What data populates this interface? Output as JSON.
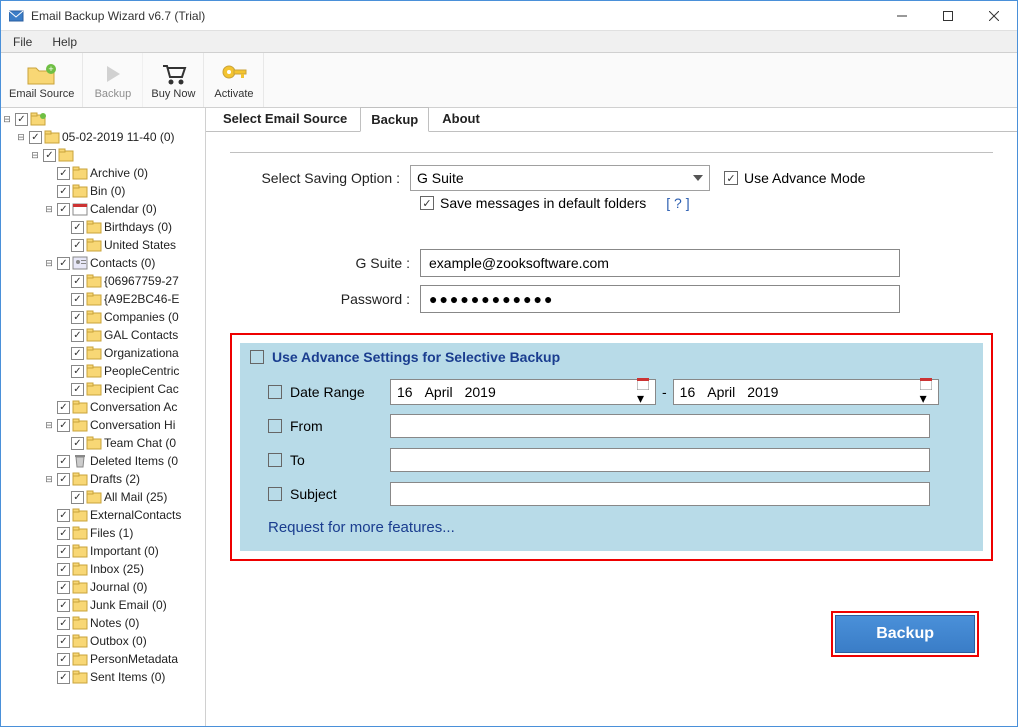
{
  "titlebar": {
    "title": "Email Backup Wizard v6.7 (Trial)"
  },
  "menu": {
    "file": "File",
    "help": "Help"
  },
  "toolbar": {
    "email_source": "Email Source",
    "backup": "Backup",
    "buy_now": "Buy Now",
    "activate": "Activate"
  },
  "tree": [
    {
      "indent": 0,
      "toggle": "-",
      "icon": "root",
      "label": ""
    },
    {
      "indent": 14,
      "toggle": "-",
      "icon": "folder",
      "label": "05-02-2019 11-40 (0)"
    },
    {
      "indent": 28,
      "toggle": "-",
      "icon": "folder",
      "label": ""
    },
    {
      "indent": 42,
      "toggle": "",
      "icon": "folder",
      "label": "Archive (0)"
    },
    {
      "indent": 42,
      "toggle": "",
      "icon": "folder",
      "label": "Bin (0)"
    },
    {
      "indent": 42,
      "toggle": "-",
      "icon": "cal",
      "label": "Calendar (0)"
    },
    {
      "indent": 56,
      "toggle": "",
      "icon": "folder",
      "label": "Birthdays (0)"
    },
    {
      "indent": 56,
      "toggle": "",
      "icon": "folder",
      "label": "United States"
    },
    {
      "indent": 42,
      "toggle": "-",
      "icon": "contact",
      "label": "Contacts (0)"
    },
    {
      "indent": 56,
      "toggle": "",
      "icon": "folder",
      "label": "{06967759-27"
    },
    {
      "indent": 56,
      "toggle": "",
      "icon": "folder",
      "label": "{A9E2BC46-E"
    },
    {
      "indent": 56,
      "toggle": "",
      "icon": "folder",
      "label": "Companies (0"
    },
    {
      "indent": 56,
      "toggle": "",
      "icon": "folder",
      "label": "GAL Contacts"
    },
    {
      "indent": 56,
      "toggle": "",
      "icon": "folder",
      "label": "Organizationa"
    },
    {
      "indent": 56,
      "toggle": "",
      "icon": "folder",
      "label": "PeopleCentric"
    },
    {
      "indent": 56,
      "toggle": "",
      "icon": "folder",
      "label": "Recipient Cac"
    },
    {
      "indent": 42,
      "toggle": "",
      "icon": "folder",
      "label": "Conversation Ac"
    },
    {
      "indent": 42,
      "toggle": "-",
      "icon": "folder",
      "label": "Conversation Hi"
    },
    {
      "indent": 56,
      "toggle": "",
      "icon": "folder",
      "label": "Team Chat (0"
    },
    {
      "indent": 42,
      "toggle": "",
      "icon": "trash",
      "label": "Deleted Items (0"
    },
    {
      "indent": 42,
      "toggle": "-",
      "icon": "folder",
      "label": "Drafts (2)"
    },
    {
      "indent": 56,
      "toggle": "",
      "icon": "folder",
      "label": "All Mail (25)"
    },
    {
      "indent": 42,
      "toggle": "",
      "icon": "folder",
      "label": "ExternalContacts"
    },
    {
      "indent": 42,
      "toggle": "",
      "icon": "folder",
      "label": "Files (1)"
    },
    {
      "indent": 42,
      "toggle": "",
      "icon": "folder",
      "label": "Important (0)"
    },
    {
      "indent": 42,
      "toggle": "",
      "icon": "folder",
      "label": "Inbox (25)"
    },
    {
      "indent": 42,
      "toggle": "",
      "icon": "folder",
      "label": "Journal (0)"
    },
    {
      "indent": 42,
      "toggle": "",
      "icon": "folder",
      "label": "Junk Email (0)"
    },
    {
      "indent": 42,
      "toggle": "",
      "icon": "folder",
      "label": "Notes (0)"
    },
    {
      "indent": 42,
      "toggle": "",
      "icon": "folder",
      "label": "Outbox (0)"
    },
    {
      "indent": 42,
      "toggle": "",
      "icon": "folder",
      "label": "PersonMetadata"
    },
    {
      "indent": 42,
      "toggle": "",
      "icon": "folder",
      "label": "Sent Items (0)"
    }
  ],
  "tabs": {
    "select_source": "Select Email Source",
    "backup": "Backup",
    "about": "About"
  },
  "form": {
    "saving_option_label": "Select Saving Option :",
    "saving_option_value": "G Suite",
    "use_advance_mode": "Use Advance Mode",
    "save_default": "Save messages in default folders",
    "help_link": "[  ?  ]",
    "gsuite_label": "G Suite   :",
    "gsuite_value": "example@zooksoftware.com",
    "password_label": "Password :",
    "password_value": "●●●●●●●●●●●●"
  },
  "adv": {
    "title": "Use Advance Settings for Selective Backup",
    "date_range": "Date Range",
    "from": "From",
    "to": "To",
    "subject": "Subject",
    "date1": {
      "d": "16",
      "m": "April",
      "y": "2019"
    },
    "date2": {
      "d": "16",
      "m": "April",
      "y": "2019"
    },
    "more": "Request for more features..."
  },
  "backup_btn": "Backup"
}
